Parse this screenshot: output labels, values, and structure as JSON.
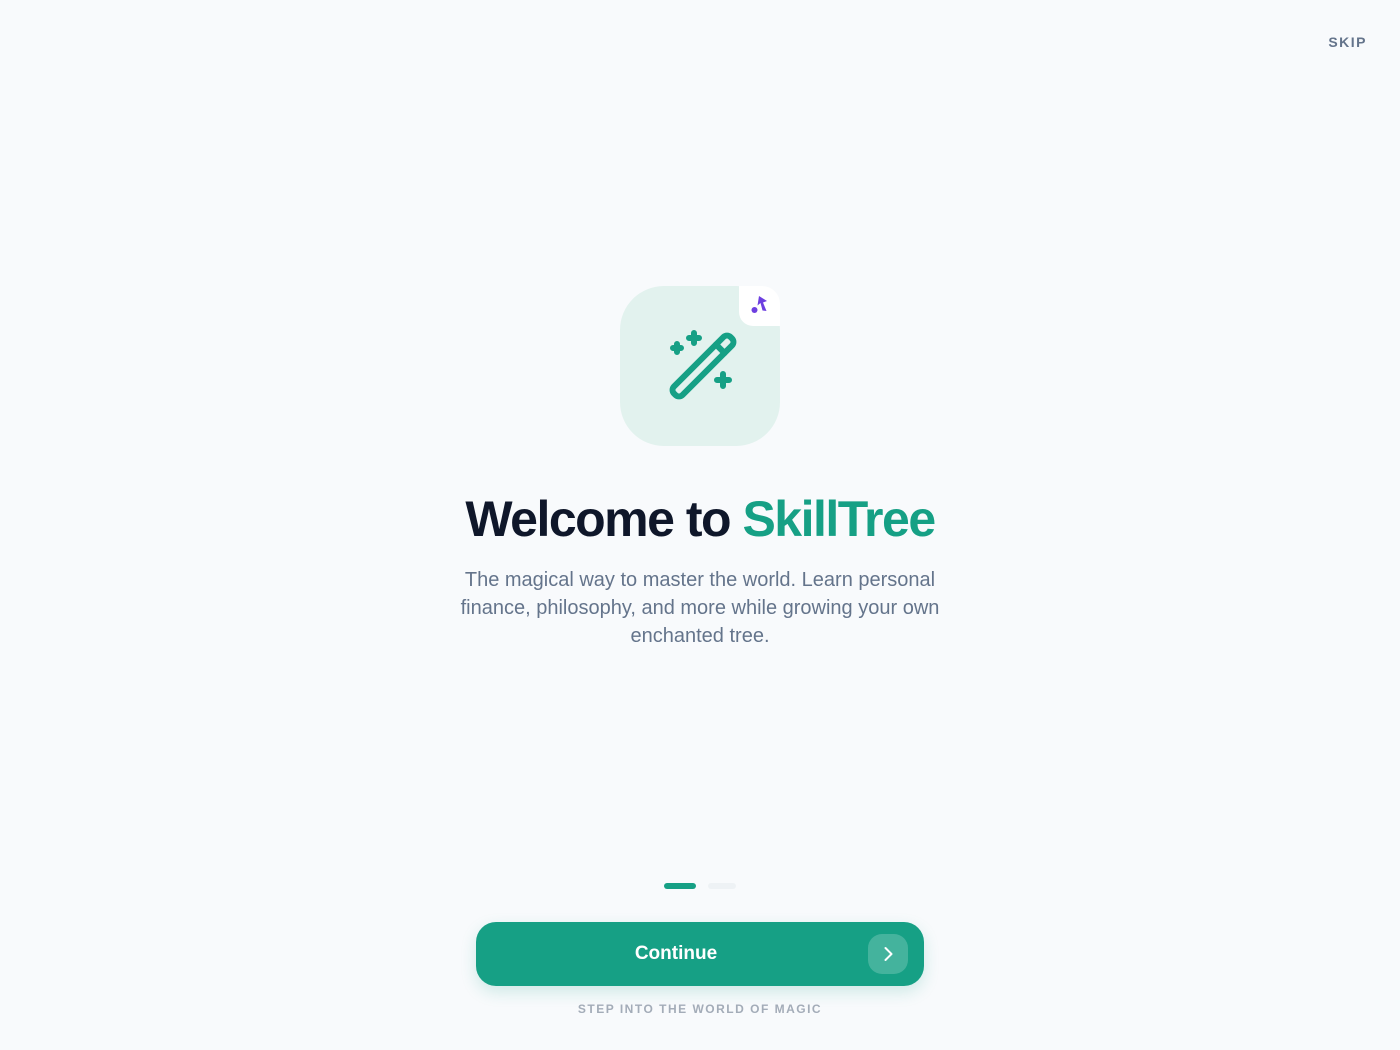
{
  "header": {
    "skip_label": "SKIP"
  },
  "hero": {
    "icon": "magic-wand-icon",
    "badge_icon": "sparkle-pin-icon"
  },
  "content": {
    "title_prefix": "Welcome to ",
    "title_brand": "SkillTree",
    "subtitle": "The magical way to master the world. Learn personal finance, philosophy, and more while growing your own enchanted tree."
  },
  "pagination": {
    "current_page": 1,
    "total_pages": 2
  },
  "footer": {
    "continue_label": "Continue",
    "continue_icon": "chevron-right-icon",
    "tagline": "STEP INTO THE WORLD OF MAGIC"
  },
  "colors": {
    "brand": "#16a085",
    "heading": "#0f172a",
    "body_text": "#64748b",
    "hero_bg": "#e2f2ee",
    "badge_accent": "#6d3fe0",
    "background": "#f8fafc"
  }
}
